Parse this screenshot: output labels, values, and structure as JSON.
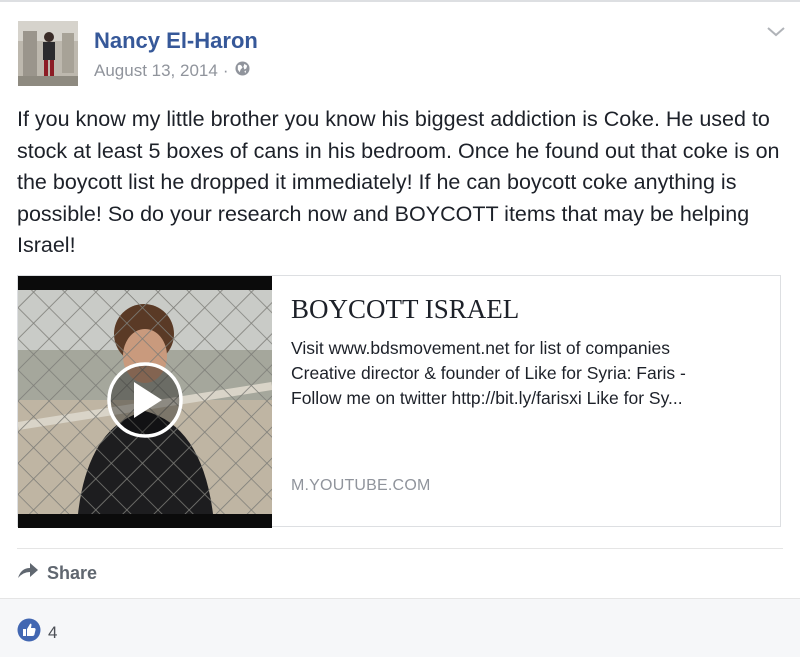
{
  "post": {
    "author": "Nancy El-Haron",
    "date": "August 13, 2014",
    "separator": "·",
    "privacy_icon": "globe-icon",
    "options_icon": "chevron-down-icon",
    "text": "If you know my little brother you know his biggest addiction is Coke. He used to stock at least 5 boxes of cans in his bedroom. Once he found out that coke is on the boycott list he dropped it immediately! If he can boycott coke anything is possible! So do your research now and BOYCOTT items that may be helping Israel!"
  },
  "attachment": {
    "title": "BOYCOTT ISRAEL",
    "description_lines": [
      "Visit www.bdsmovement.net for list of companies",
      "Creative director & founder of Like for Syria: Faris -",
      "Follow me on twitter http://bit.ly/farisxi Like for Sy..."
    ],
    "domain": "M.YOUTUBE.COM",
    "thumbnail_icon": "play-icon"
  },
  "actions": {
    "share_label": "Share",
    "share_icon": "share-arrow-icon"
  },
  "reactions": {
    "like_count": "4",
    "like_icon": "thumbs-up-icon"
  },
  "colors": {
    "link": "#365899",
    "meta": "#90949c",
    "like_blue": "#4267b2"
  }
}
